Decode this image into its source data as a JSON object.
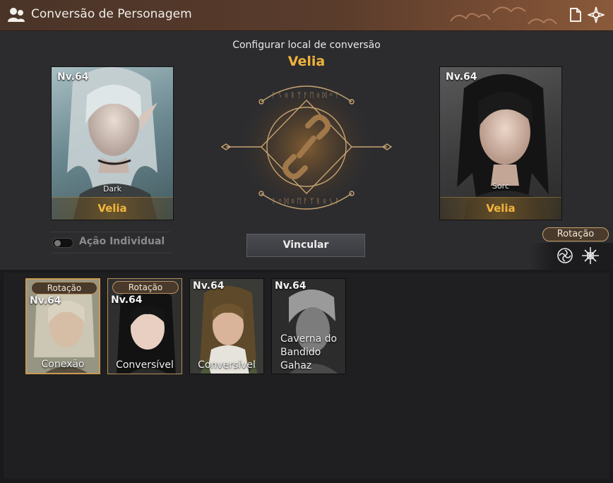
{
  "window": {
    "title": "Conversão de Personagem"
  },
  "config": {
    "label": "Configurar local de conversão",
    "city": "Velia"
  },
  "left_character": {
    "level": "Nv.64",
    "class": "Dark",
    "city": "Velia"
  },
  "right_character": {
    "level": "Nv.64",
    "class": "Sorc",
    "city": "Velia"
  },
  "toggle": {
    "label": "Ação Individual",
    "on": false
  },
  "link_button": {
    "label": "Vincular"
  },
  "rotation": {
    "label": "Rotação",
    "icons": [
      "rose-crest-icon",
      "cross-sigil-icon"
    ]
  },
  "cards": [
    {
      "badge": "Rotação",
      "level": "Nv.64",
      "status": "Conexão",
      "selected": true
    },
    {
      "badge": "Rotação",
      "level": "Nv.64",
      "status": "Conversível",
      "selected": false
    },
    {
      "level": "Nv.64",
      "status": "Conversível"
    },
    {
      "level": "Nv.64",
      "location": [
        "Caverna do",
        "Bandido",
        "Gahaz"
      ]
    }
  ],
  "colors": {
    "accent_gold": "#f0b23c",
    "title_bar": "#5a3c2c",
    "panel": "#2c2c2f",
    "card_border": "#c99a55"
  }
}
